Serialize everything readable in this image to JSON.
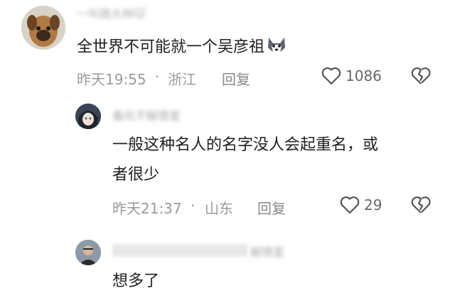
{
  "comment": {
    "username": "一叫我大林🐱",
    "text": "全世界不可能就一个吴彦祖",
    "emoji_icon": "husky-face-icon",
    "time": "昨天19:55",
    "location": "浙江",
    "reply_label": "回复",
    "likes": "1086"
  },
  "replies": [
    {
      "username": "春风不解情爱",
      "text_line1": "一般这种名人的名字没人会起重名，或",
      "text_line2": "者很少",
      "time": "昨天21:37",
      "location": "山东",
      "reply_label": "回复",
      "likes": "29"
    },
    {
      "username": "解情爱",
      "text": "想多了"
    }
  ],
  "icons": {
    "like": "heart-outline-icon",
    "dislike": "broken-heart-icon"
  },
  "colors": {
    "meta": "#9a9a9a",
    "text": "#1f1f1f",
    "icon": "#555555"
  }
}
